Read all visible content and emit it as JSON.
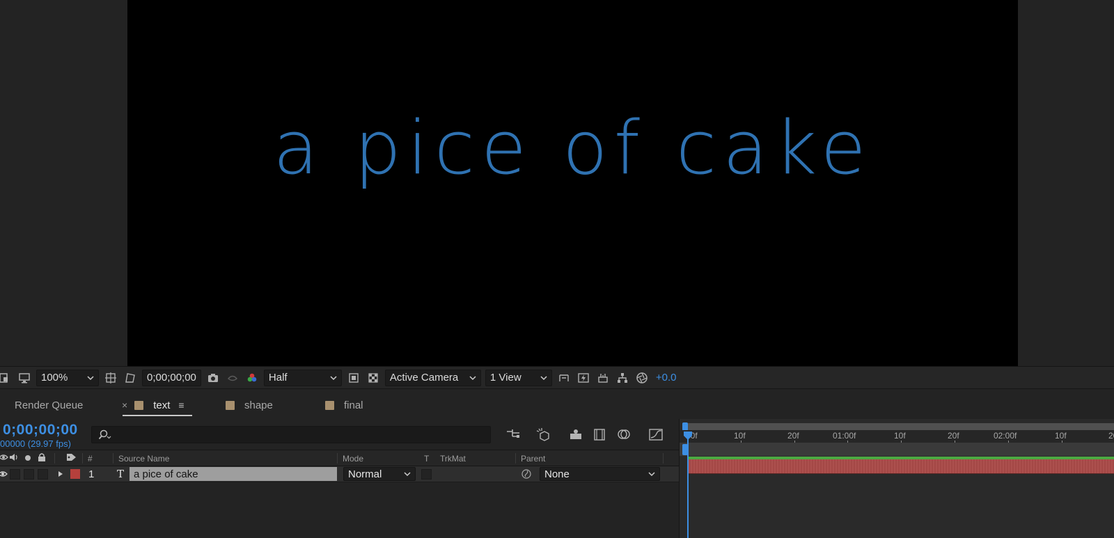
{
  "composition": {
    "text": "a pice of cake",
    "text_color": "#2f72b2",
    "background": "#000000"
  },
  "viewer_toolbar": {
    "zoom": "100%",
    "timecode": "0;00;00;00",
    "resolution": "Half",
    "camera": "Active Camera",
    "views": "1 View",
    "exposure": "+0.0",
    "icons": [
      "region-icon",
      "monitor-icon",
      "safe-margins-icon",
      "mask-icon",
      "snapshot-icon",
      "show-snapshot-icon",
      "channel-icon",
      "region-of-interest-icon",
      "transparency-grid-icon",
      "reset-view-icon",
      "fast-preview-icon",
      "timeline-icon",
      "flowchart-icon",
      "exposure-icon"
    ]
  },
  "tabs": {
    "render_queue": "Render Queue",
    "text": "text",
    "shape": "shape",
    "final": "final",
    "close": "×",
    "menu": "≡"
  },
  "timeline": {
    "current_time": "0;00;00;00",
    "frame_fps": "00000 (29.97 fps)",
    "columns": {
      "number": "#",
      "source_name": "Source Name",
      "mode": "Mode",
      "t": "T",
      "trkmat": "TrkMat",
      "parent": "Parent"
    },
    "layer": {
      "number": "1",
      "type_glyph": "T",
      "name": "a pice of cake",
      "mode": "Normal",
      "parent": "None",
      "label_color": "#b6403c"
    },
    "ruler_ticks": [
      "00f",
      "10f",
      "20f",
      "01:00f",
      "10f",
      "20f",
      "02:00f",
      "10f",
      "20"
    ],
    "accent": "#3d8fe3",
    "layer_bar_color": "#a94a48"
  }
}
